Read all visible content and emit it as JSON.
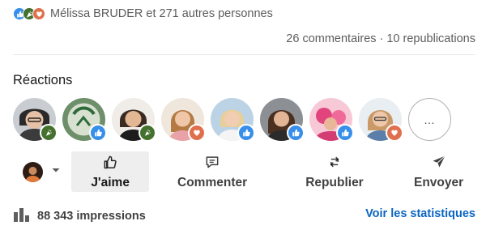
{
  "social": {
    "summary_text": "Mélissa BRUDER et 271 autres personnes",
    "comments": "26 commentaires",
    "separator": "·",
    "reposts": "10 republications"
  },
  "reactions": {
    "title": "Réactions",
    "more_label": "…",
    "avatars": [
      {
        "badge": "celebrate-icon"
      },
      {
        "badge": "like-icon"
      },
      {
        "badge": "celebrate-icon"
      },
      {
        "badge": "love-icon"
      },
      {
        "badge": "like-icon"
      },
      {
        "badge": "like-icon"
      },
      {
        "badge": "like-icon"
      },
      {
        "badge": "love-icon"
      }
    ]
  },
  "actions": {
    "like": "J'aime",
    "comment": "Commenter",
    "repost": "Republier",
    "send": "Envoyer"
  },
  "footer": {
    "impressions": "88 343 impressions",
    "stats_link": "Voir les statistiques"
  },
  "colors": {
    "link": "#0a66c2",
    "like": "#378fe9",
    "celebrate": "#44712e",
    "love": "#df704d"
  }
}
